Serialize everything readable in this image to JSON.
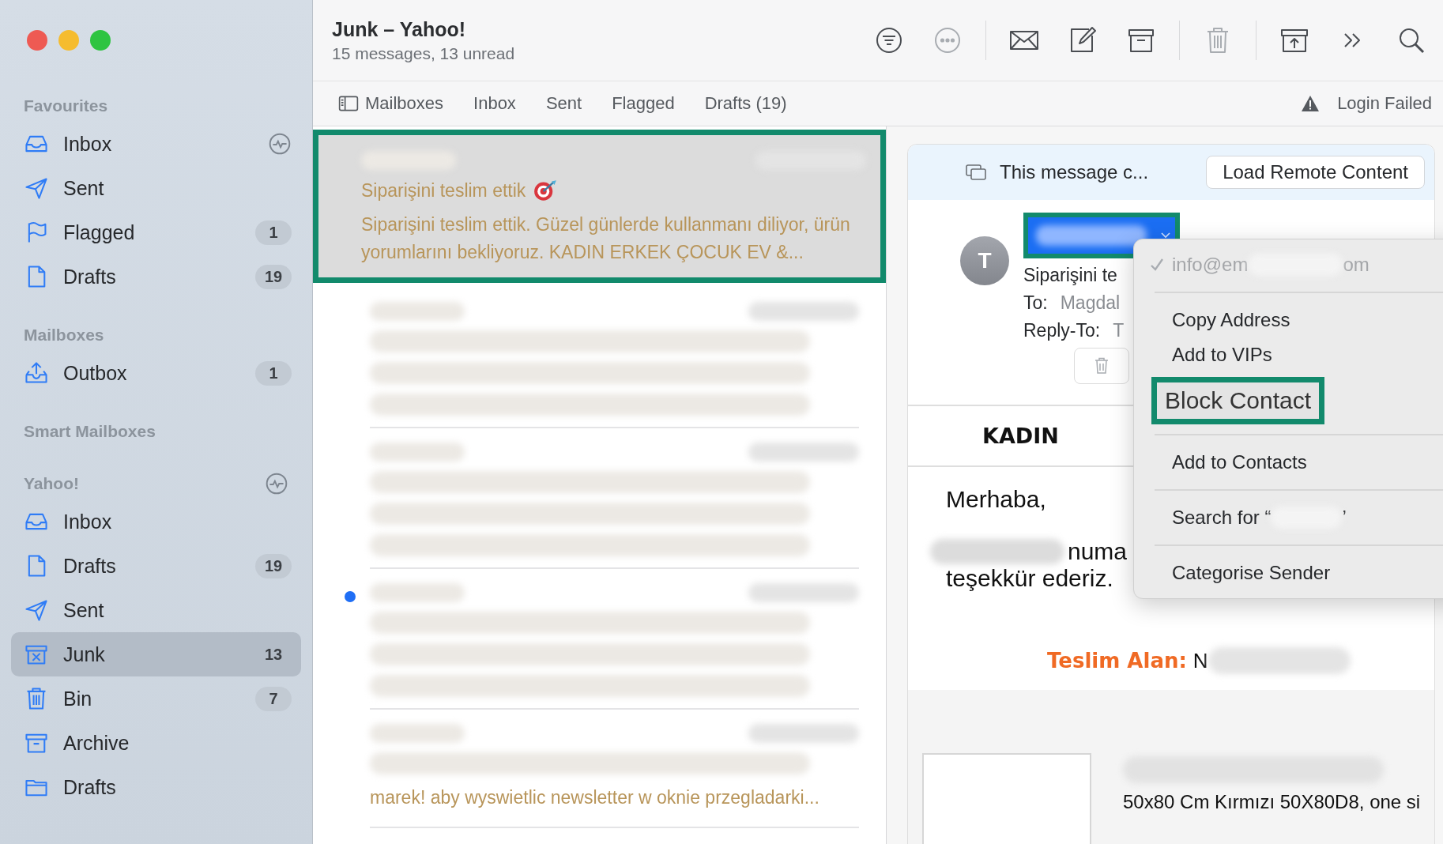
{
  "window": {
    "title": "Junk – Yahoo!",
    "subtitle": "15 messages, 13 unread"
  },
  "sidebar": {
    "sections": [
      {
        "title": "Favourites",
        "items": [
          {
            "label": "Inbox",
            "kind": "inbox",
            "indicator": true,
            "selected": false
          },
          {
            "label": "Sent",
            "kind": "sent",
            "indicator": false,
            "selected": false
          },
          {
            "label": "Flagged",
            "kind": "flagged",
            "indicator": false,
            "badge": "1",
            "selected": false
          },
          {
            "label": "Drafts",
            "kind": "drafts",
            "indicator": false,
            "badge": "19",
            "selected": false
          }
        ]
      },
      {
        "title": "Mailboxes",
        "items": [
          {
            "label": "Outbox",
            "kind": "outbox",
            "indicator": false,
            "badge": "1",
            "selected": false
          }
        ]
      },
      {
        "title": "Smart Mailboxes"
      },
      {
        "title": "Yahoo!",
        "indicator": true,
        "items": [
          {
            "label": "Inbox",
            "kind": "inbox",
            "indicator": false,
            "selected": false
          },
          {
            "label": "Drafts",
            "kind": "drafts",
            "indicator": false,
            "badge": "19",
            "selected": false
          },
          {
            "label": "Sent",
            "kind": "sent",
            "indicator": false,
            "selected": false
          },
          {
            "label": "Junk",
            "kind": "junk",
            "indicator": false,
            "badge": "13",
            "selected": true
          },
          {
            "label": "Bin",
            "kind": "trash",
            "indicator": false,
            "badge": "7",
            "selected": false
          },
          {
            "label": "Archive",
            "kind": "archive",
            "indicator": false,
            "selected": false
          },
          {
            "label": "Drafts",
            "kind": "folder",
            "indicator": false,
            "selected": false
          }
        ]
      }
    ]
  },
  "toolbar": {
    "buttons": [
      {
        "kind": "filter"
      },
      {
        "kind": "more",
        "disabled": true
      },
      {
        "kind": "mail",
        "separator_before": true
      },
      {
        "kind": "compose"
      },
      {
        "kind": "archive"
      },
      {
        "kind": "trash",
        "disabled": true,
        "separator_before": true
      },
      {
        "kind": "junk",
        "separator_before": true
      },
      {
        "kind": "overflow"
      },
      {
        "kind": "search"
      }
    ]
  },
  "favourites_bar": {
    "items": [
      {
        "label": "Mailboxes",
        "kind": "mailboxes"
      },
      {
        "label": "Inbox",
        "kind": "plain"
      },
      {
        "label": "Sent",
        "kind": "plain"
      },
      {
        "label": "Flagged",
        "kind": "plain"
      },
      {
        "label": "Drafts (19)",
        "kind": "plain"
      }
    ],
    "status": "Login Failed"
  },
  "messages": [
    {
      "subject": "Siparişini teslim ettik",
      "preview": "Siparişini teslim ettik. Güzel günlerde kullanmanı diliyor, ürün yorumlarını bekliyoruz. KADIN ERKEK ÇOCUK EV &...",
      "selected": true
    },
    {
      "selected": false
    },
    {
      "selected": false
    },
    {
      "selected": false,
      "unread": true
    },
    {
      "preview": "marek! aby wyswietlic newsletter w oknie przegladarki...",
      "selected": false
    }
  ],
  "reader": {
    "banner": {
      "text": "This message c...",
      "button": "Load Remote Content"
    },
    "header": {
      "avatar": "T",
      "subject": "Siparişini te",
      "to_label": "To:",
      "to": "Magdal",
      "reply_label": "Reply-To:",
      "reply": "T"
    },
    "body": {
      "heading": "KADIN",
      "greeting": "Merhaba,",
      "line1": "numa",
      "line2": "teşekkür ederiz.",
      "delivery_label": "Teslim Alan:",
      "delivery_value": "N",
      "product": "50x80 Cm Kırmızı 50X80D8, one si"
    }
  },
  "menu": {
    "items": [
      {
        "kind": "address",
        "label_start": "info@em",
        "label_end": "om",
        "checked": true,
        "disabled": true
      },
      {
        "kind": "separator"
      },
      {
        "kind": "item",
        "label": "Copy Address"
      },
      {
        "kind": "item",
        "label": "Add to VIPs"
      },
      {
        "kind": "item",
        "label": "Block Contact",
        "highlighted": true
      },
      {
        "kind": "separator"
      },
      {
        "kind": "item",
        "label": "Add to Contacts"
      },
      {
        "kind": "separator"
      },
      {
        "kind": "search",
        "label_start": "Search for “",
        "label_end": "’"
      },
      {
        "kind": "separator"
      },
      {
        "kind": "item",
        "label": "Categorise Sender"
      }
    ]
  }
}
